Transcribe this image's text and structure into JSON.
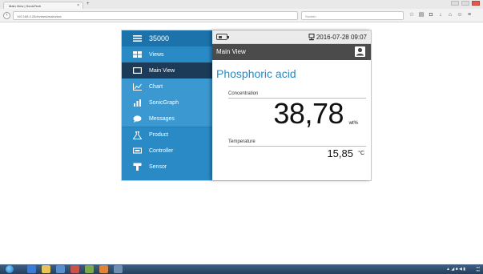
{
  "browser": {
    "tab_title": "Main View | SonicTech",
    "tab_close": "×",
    "new_tab": "+",
    "url": "192.168.0.25/#/views/mainview",
    "search_placeholder": "Suchen"
  },
  "app": {
    "device_id": "35000",
    "sidebar": {
      "views_label": "Views",
      "main_view_label": "Main View",
      "chart_label": "Chart",
      "sonicgraph_label": "SonicGraph",
      "messages_label": "Messages",
      "product_label": "Product",
      "controller_label": "Controller",
      "sensor_label": "Sensor"
    },
    "status": {
      "datetime": "2016-07-28 09:07"
    },
    "title": "Main View",
    "product_name": "Phosphoric acid",
    "concentration": {
      "label": "Concentration",
      "value": "38,78",
      "unit": "wt%"
    },
    "temperature": {
      "label": "Temperature",
      "value": "15,85",
      "unit": "°C"
    }
  },
  "colors": {
    "accent": "#2a8ac5",
    "sidebar_active": "#1b3b59",
    "title_bar": "#4b4b4b"
  }
}
